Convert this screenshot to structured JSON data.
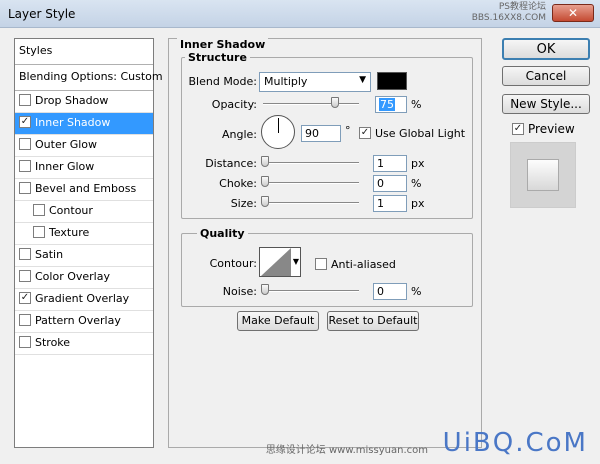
{
  "window": {
    "title": "Layer Style",
    "close_glyph": "✕",
    "watermark_top_1": "PS教程论坛",
    "watermark_top_2": "BBS.16XX8.COM"
  },
  "styles_list": {
    "header": "Styles",
    "blending": "Blending Options: Custom",
    "items": [
      {
        "label": "Drop Shadow",
        "checked": false,
        "selected": false,
        "indent": false
      },
      {
        "label": "Inner Shadow",
        "checked": true,
        "selected": true,
        "indent": false
      },
      {
        "label": "Outer Glow",
        "checked": false,
        "selected": false,
        "indent": false
      },
      {
        "label": "Inner Glow",
        "checked": false,
        "selected": false,
        "indent": false
      },
      {
        "label": "Bevel and Emboss",
        "checked": false,
        "selected": false,
        "indent": false
      },
      {
        "label": "Contour",
        "checked": false,
        "selected": false,
        "indent": true
      },
      {
        "label": "Texture",
        "checked": false,
        "selected": false,
        "indent": true
      },
      {
        "label": "Satin",
        "checked": false,
        "selected": false,
        "indent": false
      },
      {
        "label": "Color Overlay",
        "checked": false,
        "selected": false,
        "indent": false
      },
      {
        "label": "Gradient Overlay",
        "checked": true,
        "selected": false,
        "indent": false
      },
      {
        "label": "Pattern Overlay",
        "checked": false,
        "selected": false,
        "indent": false
      },
      {
        "label": "Stroke",
        "checked": false,
        "selected": false,
        "indent": false
      }
    ]
  },
  "inner_shadow": {
    "title": "Inner Shadow",
    "structure": {
      "title": "Structure",
      "blend_mode_label": "Blend Mode:",
      "blend_mode_value": "Multiply",
      "shadow_color": "#000000",
      "opacity_label": "Opacity:",
      "opacity_value": "75",
      "opacity_fraction": 0.75,
      "opacity_unit": "%",
      "angle_label": "Angle:",
      "angle_value": "90",
      "angle_unit": "°",
      "use_global_light_label": "Use Global Light",
      "use_global_light": true,
      "distance_label": "Distance:",
      "distance_value": "1",
      "distance_unit": "px",
      "choke_label": "Choke:",
      "choke_value": "0",
      "choke_unit": "%",
      "size_label": "Size:",
      "size_value": "1",
      "size_unit": "px"
    },
    "quality": {
      "title": "Quality",
      "contour_label": "Contour:",
      "anti_aliased_label": "Anti-aliased",
      "anti_aliased": false,
      "noise_label": "Noise:",
      "noise_value": "0",
      "noise_unit": "%"
    },
    "make_default_label": "Make Default",
    "reset_default_label": "Reset to Default"
  },
  "actions": {
    "ok": "OK",
    "cancel": "Cancel",
    "new_style": "New Style...",
    "preview_label": "Preview",
    "preview_checked": true
  },
  "watermark": {
    "main": "UiBQ.CoM",
    "sub": "思缘设计论坛 www.missyuan.com"
  },
  "colors": {
    "selection": "#3399ff",
    "ok_border": "#3c7fb1"
  }
}
